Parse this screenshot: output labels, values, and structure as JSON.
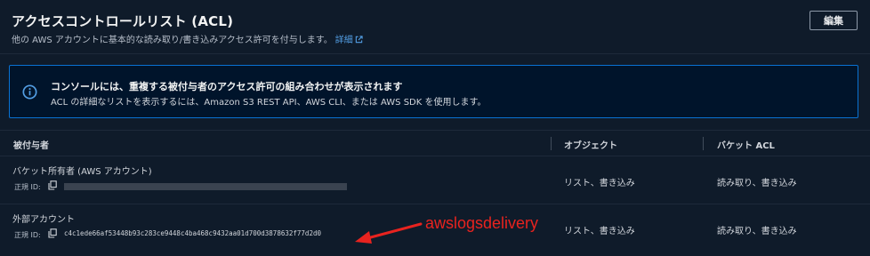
{
  "header": {
    "title": "アクセスコントロールリスト (ACL)",
    "description": "他の AWS アカウントに基本的な読み取り/書き込みアクセス許可を付与します。",
    "link_label": "詳細",
    "edit_label": "編集"
  },
  "alert": {
    "title": "コンソールには、重複する被付与者のアクセス許可の組み合わせが表示されます",
    "body": "ACL の詳細なリストを表示するには、Amazon S3 REST API、AWS CLI、または AWS SDK を使用します。"
  },
  "table": {
    "columns": [
      "被付与者",
      "オブジェクト",
      "バケット ACL"
    ],
    "rows": [
      {
        "grantee": "バケット所有者 (AWS アカウント)",
        "canonical_id_label": "正規 ID:",
        "canonical_id": "",
        "object_perm": "リスト、書き込み",
        "bucket_acl_perm": "読み取り、書き込み"
      },
      {
        "grantee": "外部アカウント",
        "canonical_id_label": "正規 ID:",
        "canonical_id": "c4c1ede66af53448b93c283ce9448c4ba468c9432aa01d700d3878632f77d2d0",
        "object_perm": "リスト、書き込み",
        "bucket_acl_perm": "読み取り、書き込み"
      }
    ]
  },
  "annotation": {
    "label": "awslogsdelivery",
    "color": "#e8231f"
  },
  "colors": {
    "background": "#0f1b2a",
    "info_accent": "#0972d3",
    "link": "#539fe5"
  }
}
